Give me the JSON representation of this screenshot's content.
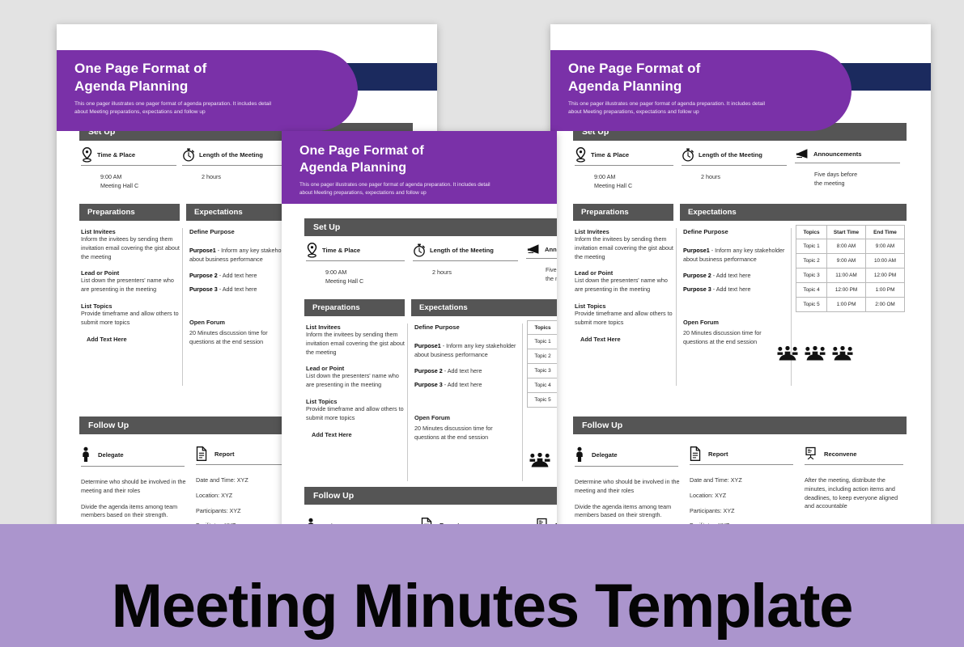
{
  "banner": {
    "title": "Meeting Minutes Template",
    "bg_color": "#ab95cd",
    "text_color": "#050505"
  },
  "theme": {
    "purple": "#7a31a8",
    "navy": "#1b2a5e",
    "band_gray": "#555555",
    "page_bg": "#e3e3e3",
    "card_bg": "#ffffff"
  },
  "document": {
    "hero": {
      "title_line1": "One Page Format of",
      "title_line2": "Agenda Planning",
      "subtitle_line1": "This one pager illustrates one pager format of agenda preparation.  It includes detail",
      "subtitle_line2": "about Meeting preparations, expectations and   follow up"
    },
    "setup": {
      "band_label": "Set Up",
      "features": [
        {
          "icon": "location-pin-icon",
          "title": "Time & Place",
          "lines": [
            "9:00 AM",
            "Meeting Hall C"
          ]
        },
        {
          "icon": "stopwatch-icon",
          "title": "Length of the Meeting",
          "lines": [
            "2 hours"
          ]
        },
        {
          "icon": "megaphone-icon",
          "title": "Announcements",
          "lines": [
            "Five days before",
            "the meeting"
          ]
        }
      ]
    },
    "preparations": {
      "band_label": "Preparations",
      "blocks": [
        {
          "heading": "List Invitees",
          "body": "Inform the invitees by sending them invitation email covering the gist about the meeting"
        },
        {
          "heading": "Lead or Point",
          "body": "List down the presenters' name who are presenting in the meeting"
        },
        {
          "heading": "List Topics",
          "body": "Provide timeframe and allow others to submit more topics"
        }
      ],
      "footer": "Add   Text Here"
    },
    "expectations": {
      "band_label": "Expectations",
      "define_purpose_heading": "Define Purpose",
      "purposes": [
        {
          "label": "Purpose1",
          "text": " - Inform any key stakeholder about business performance"
        },
        {
          "label": "Purpose 2",
          "text": " - Add text here"
        },
        {
          "label": "Purpose 3",
          "text": " - Add text here"
        }
      ],
      "open_forum_heading": "Open Forum",
      "open_forum_body": "20 Minutes discussion time for questions at the end session",
      "people_icons": 3
    },
    "schedule": {
      "columns": [
        "Topics",
        "Start Time",
        "End Time"
      ],
      "rows": [
        [
          "Topic 1",
          "8:00 AM",
          "9:00 AM"
        ],
        [
          "Topic 2",
          "9:00 AM",
          "10:00 AM"
        ],
        [
          "Topic 3",
          "11:00 AM",
          "12:00 PM"
        ],
        [
          "Topic 4",
          "12:00  PM",
          "1:00 PM"
        ],
        [
          "Topic 5",
          "1:00 PM",
          "2:00 OM"
        ]
      ]
    },
    "followup": {
      "band_label": "Follow Up",
      "features": [
        {
          "icon": "person-icon",
          "title": "Delegate",
          "paragraphs": [
            "Determine who should be involved in the meeting and their roles",
            "Divide the agenda items among team members based on their strength."
          ]
        },
        {
          "icon": "document-icon",
          "title": "Report",
          "paragraphs": [
            "Date and Time:  XYZ",
            "Location:  XYZ",
            "Participants: XYZ",
            "Facilitator: XYZ"
          ]
        },
        {
          "icon": "presentation-board-icon",
          "title": "Reconvene",
          "paragraphs": [
            "After the meeting, distribute the minutes, including action items and deadlines, to keep everyone aligned and accountable"
          ]
        }
      ]
    }
  }
}
